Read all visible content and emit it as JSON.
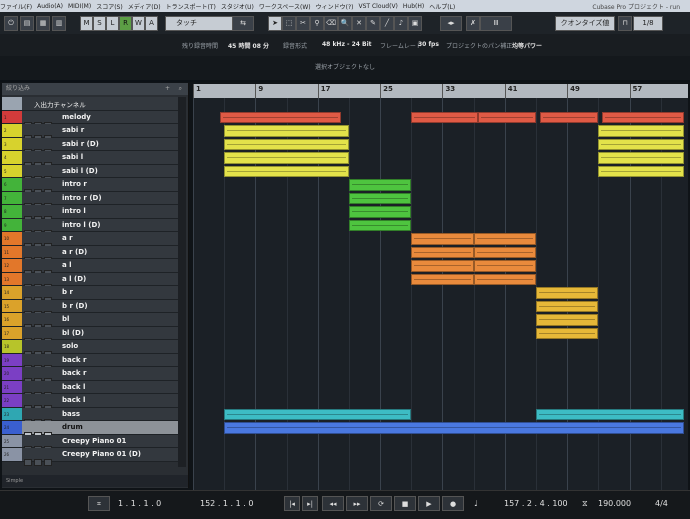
{
  "menu": {
    "items": [
      "ファイル(F)",
      "Audio(A)",
      "MIDI(M)",
      "スコア(S)",
      "メディア(D)",
      "トランスポート(T)",
      "スタジオ(U)",
      "ワークスペース(W)",
      "ウィンドウ(?)",
      "VST Cloud(V)",
      "Hub(H)",
      "ヘルプ(L)"
    ],
    "window_title": "Cubase Pro プロジェクト - run"
  },
  "toolbar": {
    "mode_buttons": [
      "M",
      "S",
      "L",
      "R",
      "W",
      "A"
    ],
    "touch_label": "タッチ",
    "quantize_label": "クオンタイズ値",
    "grid_value": "1/8"
  },
  "info_line": {
    "remaining_label": "残り録音時間",
    "remaining_value": "45 時間 08 分",
    "format_label": "録音形式",
    "format_value": "48 kHz - 24 Bit",
    "framerate_label": "フレームレート",
    "framerate_value": "30 fps",
    "pan_label": "プロジェクトのパン補正",
    "pan_value": "均等パワー"
  },
  "status": {
    "text": "選択オブジェクトなし"
  },
  "track_list": {
    "header": "絞り込み",
    "footer": "Simple",
    "tracks": [
      {
        "num": "",
        "name": "入出力チャンネル",
        "color": "#9aa4b0",
        "selected": false,
        "inout": true
      },
      {
        "num": "1",
        "name": "melody",
        "color": "#d23b3b",
        "selected": false,
        "inout": false
      },
      {
        "num": "2",
        "name": "sabi r",
        "color": "#d7d22d",
        "selected": false,
        "inout": false
      },
      {
        "num": "3",
        "name": "sabi r (D)",
        "color": "#d7d22d",
        "selected": false,
        "inout": false
      },
      {
        "num": "4",
        "name": "sabi l",
        "color": "#d7d22d",
        "selected": false,
        "inout": false
      },
      {
        "num": "5",
        "name": "sabi l (D)",
        "color": "#d7d22d",
        "selected": false,
        "inout": false
      },
      {
        "num": "6",
        "name": "intro r",
        "color": "#43b33a",
        "selected": false,
        "inout": false
      },
      {
        "num": "7",
        "name": "intro r (D)",
        "color": "#43b33a",
        "selected": false,
        "inout": false
      },
      {
        "num": "8",
        "name": "intro l",
        "color": "#43b33a",
        "selected": false,
        "inout": false
      },
      {
        "num": "9",
        "name": "intro l (D)",
        "color": "#43b33a",
        "selected": false,
        "inout": false
      },
      {
        "num": "10",
        "name": "a r",
        "color": "#e2772a",
        "selected": false,
        "inout": false
      },
      {
        "num": "11",
        "name": "a r (D)",
        "color": "#e2772a",
        "selected": false,
        "inout": false
      },
      {
        "num": "12",
        "name": "a l",
        "color": "#e2772a",
        "selected": false,
        "inout": false
      },
      {
        "num": "13",
        "name": "a l (D)",
        "color": "#e2772a",
        "selected": false,
        "inout": false
      },
      {
        "num": "14",
        "name": "b r",
        "color": "#dba22a",
        "selected": false,
        "inout": false
      },
      {
        "num": "15",
        "name": "b r (D)",
        "color": "#dba22a",
        "selected": false,
        "inout": false
      },
      {
        "num": "16",
        "name": "bl",
        "color": "#dba22a",
        "selected": false,
        "inout": false
      },
      {
        "num": "17",
        "name": "bl (D)",
        "color": "#dba22a",
        "selected": false,
        "inout": false
      },
      {
        "num": "18",
        "name": "solo",
        "color": "#b7c42a",
        "selected": false,
        "inout": false
      },
      {
        "num": "19",
        "name": "back r",
        "color": "#7b3fc4",
        "selected": false,
        "inout": false
      },
      {
        "num": "20",
        "name": "back r",
        "color": "#7b3fc4",
        "selected": false,
        "inout": false
      },
      {
        "num": "21",
        "name": "back l",
        "color": "#7b3fc4",
        "selected": false,
        "inout": false
      },
      {
        "num": "22",
        "name": "back l",
        "color": "#7b3fc4",
        "selected": false,
        "inout": false
      },
      {
        "num": "23",
        "name": "bass",
        "color": "#2fa7b2",
        "selected": false,
        "inout": false
      },
      {
        "num": "24",
        "name": "drum",
        "color": "#3a5fcf",
        "selected": true,
        "inout": false
      },
      {
        "num": "25",
        "name": "Creepy Piano 01",
        "color": "#8a93a5",
        "selected": false,
        "inout": false
      },
      {
        "num": "26",
        "name": "Creepy Piano 01 (D)",
        "color": "#8a93a5",
        "selected": false,
        "inout": false
      }
    ]
  },
  "ruler": {
    "bars": [
      "1",
      "9",
      "17",
      "25",
      "33",
      "41",
      "49",
      "57"
    ]
  },
  "events": [
    {
      "track": 1,
      "start": 4.5,
      "end": 20,
      "color": "#e05a45"
    },
    {
      "track": 1,
      "start": 29,
      "end": 37.5,
      "color": "#e05a45"
    },
    {
      "track": 1,
      "start": 37.5,
      "end": 45,
      "color": "#e05a45"
    },
    {
      "track": 1,
      "start": 45.5,
      "end": 53,
      "color": "#e05a45"
    },
    {
      "track": 1,
      "start": 53.5,
      "end": 64,
      "color": "#e05a45"
    },
    {
      "track": 2,
      "start": 5,
      "end": 21,
      "color": "#e3e24a"
    },
    {
      "track": 3,
      "start": 5,
      "end": 21,
      "color": "#e3e24a"
    },
    {
      "track": 4,
      "start": 5,
      "end": 21,
      "color": "#e3e24a"
    },
    {
      "track": 5,
      "start": 5,
      "end": 21,
      "color": "#e3e24a"
    },
    {
      "track": 2,
      "start": 53,
      "end": 64,
      "color": "#e3e24a"
    },
    {
      "track": 3,
      "start": 53,
      "end": 64,
      "color": "#e3e24a"
    },
    {
      "track": 4,
      "start": 53,
      "end": 64,
      "color": "#e3e24a"
    },
    {
      "track": 5,
      "start": 53,
      "end": 64,
      "color": "#e3e24a"
    },
    {
      "track": 6,
      "start": 21,
      "end": 29,
      "color": "#4ec43f"
    },
    {
      "track": 7,
      "start": 21,
      "end": 29,
      "color": "#4ec43f"
    },
    {
      "track": 8,
      "start": 21,
      "end": 29,
      "color": "#4ec43f"
    },
    {
      "track": 9,
      "start": 21,
      "end": 29,
      "color": "#4ec43f"
    },
    {
      "track": 10,
      "start": 29,
      "end": 37,
      "color": "#e98a3c"
    },
    {
      "track": 10,
      "start": 37,
      "end": 45,
      "color": "#e98a3c"
    },
    {
      "track": 11,
      "start": 29,
      "end": 37,
      "color": "#e98a3c"
    },
    {
      "track": 11,
      "start": 37,
      "end": 45,
      "color": "#e98a3c"
    },
    {
      "track": 12,
      "start": 29,
      "end": 37,
      "color": "#e98a3c"
    },
    {
      "track": 12,
      "start": 37,
      "end": 45,
      "color": "#e98a3c"
    },
    {
      "track": 13,
      "start": 29,
      "end": 37,
      "color": "#e98a3c"
    },
    {
      "track": 13,
      "start": 37,
      "end": 45,
      "color": "#e98a3c"
    },
    {
      "track": 14,
      "start": 45,
      "end": 53,
      "color": "#e6b838"
    },
    {
      "track": 15,
      "start": 45,
      "end": 53,
      "color": "#e6b838"
    },
    {
      "track": 16,
      "start": 45,
      "end": 53,
      "color": "#e6b838"
    },
    {
      "track": 17,
      "start": 45,
      "end": 53,
      "color": "#e6b838"
    },
    {
      "track": 23,
      "start": 5,
      "end": 29,
      "color": "#3dbcc4"
    },
    {
      "track": 23,
      "start": 45,
      "end": 64,
      "color": "#3dbcc4"
    },
    {
      "track": 24,
      "start": 5,
      "end": 64,
      "color": "#4a78e0"
    }
  ],
  "transport": {
    "left_locator": "1 . 1 . 1 . 0",
    "right_locator": "152 . 1 . 1 . 0",
    "position": "157 . 2 . 4 . 100",
    "tempo": "190.000",
    "signature": "4/4"
  }
}
